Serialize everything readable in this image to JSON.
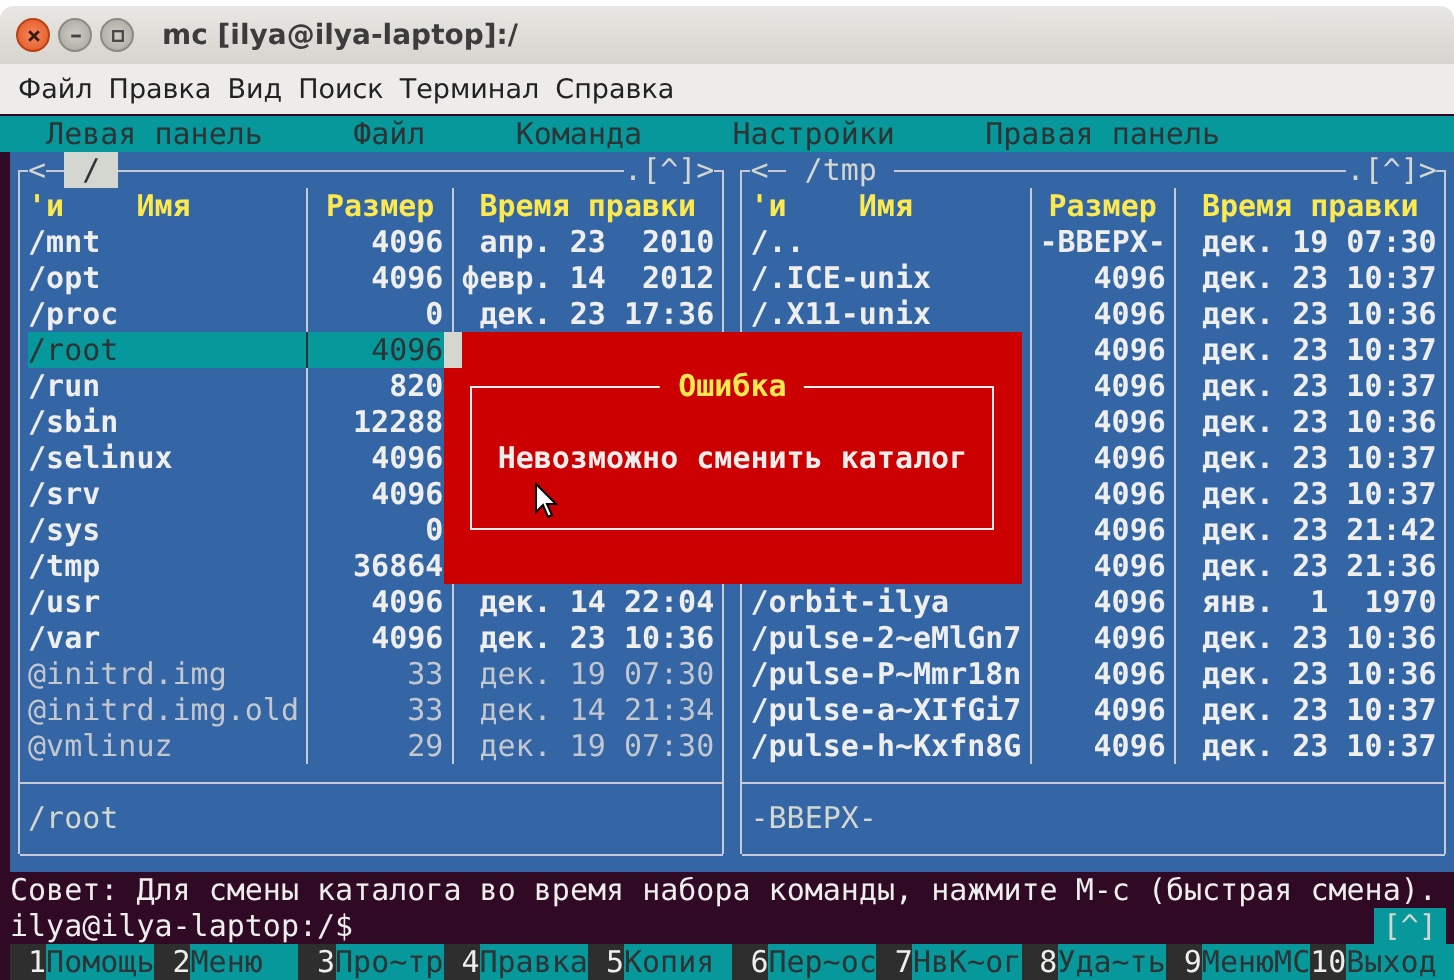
{
  "window": {
    "title": "mc [ilya@ilya-laptop]:/"
  },
  "menu_bar": [
    "Файл",
    "Правка",
    "Вид",
    "Поиск",
    "Терминал",
    "Справка"
  ],
  "mc_menu": [
    "Левая панель",
    "Файл",
    "Команда",
    "Настройки",
    "Правая панель"
  ],
  "panels": [
    {
      "arrow": "<",
      "path": "/",
      "active": true,
      "controls": ".[^]>",
      "columns": {
        "sort": "'и",
        "name": "Имя",
        "size": "Размер",
        "time": "Время правки"
      },
      "status": "/root",
      "rows": [
        {
          "name": "/mnt",
          "size": "4096",
          "time": "апр. 23  2010",
          "kind": "dir",
          "selected": false
        },
        {
          "name": "/opt",
          "size": "4096",
          "time": "февр. 14  2012",
          "kind": "dir",
          "selected": false
        },
        {
          "name": "/proc",
          "size": "0",
          "time": "дек. 23 17:36",
          "kind": "dir",
          "selected": false
        },
        {
          "name": "/root",
          "size": "4096",
          "kind": "dir",
          "selected": true
        },
        {
          "name": "/run",
          "size": "820",
          "kind": "dir",
          "selected": false
        },
        {
          "name": "/sbin",
          "size": "12288",
          "kind": "dir",
          "selected": false
        },
        {
          "name": "/selinux",
          "size": "4096",
          "kind": "dir",
          "selected": false
        },
        {
          "name": "/srv",
          "size": "4096",
          "kind": "dir",
          "selected": false
        },
        {
          "name": "/sys",
          "size": "0",
          "kind": "dir",
          "selected": false
        },
        {
          "name": "/tmp",
          "size": "36864",
          "kind": "dir",
          "selected": false
        },
        {
          "name": "/usr",
          "size": "4096",
          "time": "дек. 14 22:04",
          "kind": "dir",
          "selected": false
        },
        {
          "name": "/var",
          "size": "4096",
          "time": "дек. 23 10:36",
          "kind": "dir",
          "selected": false
        },
        {
          "name": "@initrd.img",
          "size": "33",
          "time": "дек. 19 07:30",
          "kind": "link",
          "selected": false
        },
        {
          "name": "@initrd.img.old",
          "size": "33",
          "time": "дек. 14 21:34",
          "kind": "link",
          "selected": false
        },
        {
          "name": "@vmlinuz",
          "size": "29",
          "time": "дек. 19 07:30",
          "kind": "link",
          "selected": false
        }
      ]
    },
    {
      "arrow": "<",
      "path": "/tmp",
      "active": false,
      "controls": ".[^]>",
      "columns": {
        "sort": "'и",
        "name": "Имя",
        "size": "Размер",
        "time": "Время правки"
      },
      "status": "-ВВЕРХ-",
      "rows": [
        {
          "name": "/..",
          "size": "-ВВЕРХ-",
          "time": "дек. 19 07:30",
          "kind": "dir",
          "selected": false
        },
        {
          "name": "/.ICE-unix",
          "size": "4096",
          "time": "дек. 23 10:37",
          "kind": "dir",
          "selected": false
        },
        {
          "name": "/.X11-unix",
          "size": "4096",
          "time": "дек. 23 10:36",
          "kind": "dir",
          "selected": false
        },
        {
          "size": "4096",
          "time": "дек. 23 10:37",
          "kind": "dir",
          "selected": false
        },
        {
          "size": "4096",
          "time": "дек. 23 10:37",
          "kind": "dir",
          "selected": false
        },
        {
          "size": "4096",
          "time": "дек. 23 10:36",
          "kind": "dir",
          "selected": false
        },
        {
          "size": "4096",
          "time": "дек. 23 10:37",
          "kind": "dir",
          "selected": false
        },
        {
          "size": "4096",
          "time": "дек. 23 10:37",
          "kind": "dir",
          "selected": false
        },
        {
          "size": "4096",
          "time": "дек. 23 21:42",
          "kind": "dir",
          "selected": false
        },
        {
          "size": "4096",
          "time": "дек. 23 21:36",
          "kind": "dir",
          "selected": false
        },
        {
          "name": "/orbit-ilya",
          "size": "4096",
          "time": "янв.  1  1970",
          "kind": "dir",
          "selected": false
        },
        {
          "name": "/pulse-2~eMlGn7",
          "size": "4096",
          "time": "дек. 23 10:36",
          "kind": "dir",
          "selected": false
        },
        {
          "name": "/pulse-P~Mmr18n",
          "size": "4096",
          "time": "дек. 23 10:36",
          "kind": "dir",
          "selected": false
        },
        {
          "name": "/pulse-a~XIfGi7",
          "size": "4096",
          "time": "дек. 23 10:37",
          "kind": "dir",
          "selected": false
        },
        {
          "name": "/pulse-h~Kxfn8G",
          "size": "4096",
          "time": "дек. 23 10:37",
          "kind": "dir",
          "selected": false
        }
      ]
    }
  ],
  "dialog": {
    "title": "Ошибка",
    "message": "Невозможно сменить каталог"
  },
  "hint": "Совет: Для смены каталога во время набора команды, нажмите M-c (быстрая смена).",
  "prompt": {
    "text": "ilya@ilya-laptop:/$",
    "button": "[^]"
  },
  "keybar": [
    {
      "key": "1",
      "label": "Помощь"
    },
    {
      "key": "2",
      "label": "Меню"
    },
    {
      "key": "3",
      "label": "Про~тр"
    },
    {
      "key": "4",
      "label": "Правка"
    },
    {
      "key": "5",
      "label": "Копия"
    },
    {
      "key": "6",
      "label": "Пер~ос"
    },
    {
      "key": "7",
      "label": "НвК~ог"
    },
    {
      "key": "8",
      "label": "Уда~ть"
    },
    {
      "key": "9",
      "label": "МенюМС"
    },
    {
      "key": "10",
      "label": "Выход"
    }
  ]
}
